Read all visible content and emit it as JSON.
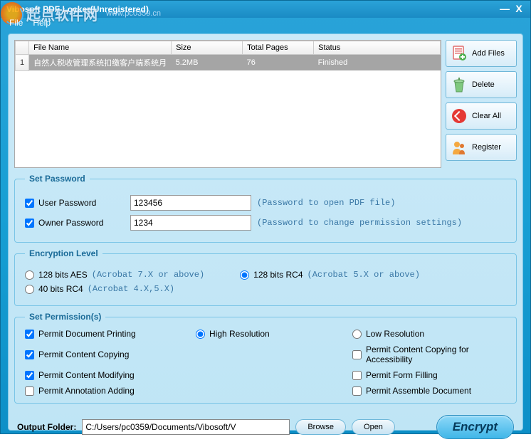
{
  "window": {
    "title": "Vibosoft PDF Locker(Unregistered)",
    "minimize": "—",
    "close": "X"
  },
  "watermark": {
    "text": "起点软件网",
    "url": "www.pc0359.cn"
  },
  "menu": {
    "file": "File",
    "help": "Help"
  },
  "table": {
    "headers": {
      "num": "",
      "name": "File Name",
      "size": "Size",
      "pages": "Total Pages",
      "status": "Status"
    },
    "rows": [
      {
        "num": "1",
        "name": "自然人税收管理系统扣缴客户端系统月",
        "size": "5.2MB",
        "pages": "76",
        "status": "Finished"
      }
    ]
  },
  "buttons": {
    "addfiles": "Add Files",
    "delete": "Delete",
    "clearall": "Clear All",
    "register": "Register"
  },
  "password": {
    "legend": "Set Password",
    "user_label": "User Password",
    "user_value": "123456",
    "user_hint": "(Password to open PDF file)",
    "owner_label": "Owner Password",
    "owner_value": "1234",
    "owner_hint": "(Password to change permission settings)"
  },
  "encryption": {
    "legend": "Encryption Level",
    "aes128": "128 bits AES",
    "aes128_hint": "(Acrobat 7.X or above)",
    "rc4128": "128 bits RC4",
    "rc4128_hint": "(Acrobat 5.X or above)",
    "rc440": "40 bits RC4",
    "rc440_hint": "(Acrobat 4.X,5.X)"
  },
  "permissions": {
    "legend": "Set Permission(s)",
    "print": "Permit Document Printing",
    "highres": "High Resolution",
    "lowres": "Low Resolution",
    "copy": "Permit Content Copying",
    "copy_acc": "Permit Content Copying for Accessibility",
    "modify": "Permit Content Modifying",
    "form": "Permit Form Filling",
    "annot": "Permit Annotation Adding",
    "assemble": "Permit Assemble Document"
  },
  "output": {
    "label": "Output Folder:",
    "path": "C:/Users/pc0359/Documents/Vibosoft/V",
    "browse": "Browse",
    "open": "Open",
    "encrypt": "Encrypt"
  }
}
